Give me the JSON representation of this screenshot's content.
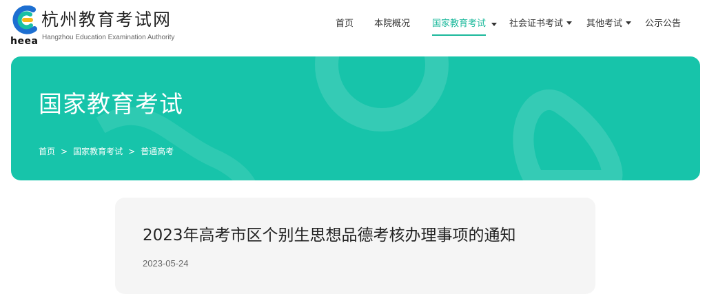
{
  "brand": {
    "name_cn": "杭州教育考试网",
    "name_en": "Hangzhou Education Examination Authority",
    "abbr": "heea",
    "colors": {
      "accent": "#17c4aa",
      "logo_blue": "#1d6fd1",
      "logo_green": "#19c0a4",
      "logo_yellow": "#f6b81a"
    }
  },
  "nav": {
    "items": [
      {
        "label": "首页",
        "has_dropdown": false,
        "active": false
      },
      {
        "label": "本院概况",
        "has_dropdown": false,
        "active": false
      },
      {
        "label": "国家教育考试",
        "has_dropdown": true,
        "active": true
      },
      {
        "label": "社会证书考试",
        "has_dropdown": true,
        "active": false
      },
      {
        "label": "其他考试",
        "has_dropdown": true,
        "active": false
      },
      {
        "label": "公示公告",
        "has_dropdown": false,
        "active": false
      }
    ]
  },
  "banner": {
    "title": "国家教育考试",
    "breadcrumb": [
      "首页",
      "国家教育考试",
      "普通高考"
    ],
    "separator": ">"
  },
  "article": {
    "title": "2023年高考市区个别生思想品德考核办理事项的通知",
    "date": "2023-05-24"
  }
}
